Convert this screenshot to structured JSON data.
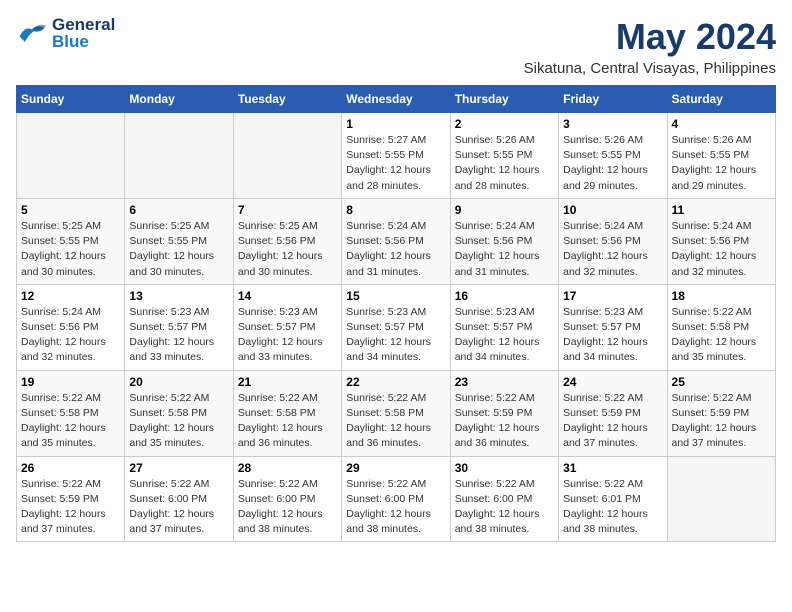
{
  "header": {
    "logo_general": "General",
    "logo_blue": "Blue",
    "title": "May 2024",
    "subtitle": "Sikatuna, Central Visayas, Philippines"
  },
  "calendar": {
    "days_of_week": [
      "Sunday",
      "Monday",
      "Tuesday",
      "Wednesday",
      "Thursday",
      "Friday",
      "Saturday"
    ],
    "weeks": [
      [
        {
          "day": "",
          "info": ""
        },
        {
          "day": "",
          "info": ""
        },
        {
          "day": "",
          "info": ""
        },
        {
          "day": "1",
          "info": "Sunrise: 5:27 AM\nSunset: 5:55 PM\nDaylight: 12 hours\nand 28 minutes."
        },
        {
          "day": "2",
          "info": "Sunrise: 5:26 AM\nSunset: 5:55 PM\nDaylight: 12 hours\nand 28 minutes."
        },
        {
          "day": "3",
          "info": "Sunrise: 5:26 AM\nSunset: 5:55 PM\nDaylight: 12 hours\nand 29 minutes."
        },
        {
          "day": "4",
          "info": "Sunrise: 5:26 AM\nSunset: 5:55 PM\nDaylight: 12 hours\nand 29 minutes."
        }
      ],
      [
        {
          "day": "5",
          "info": "Sunrise: 5:25 AM\nSunset: 5:55 PM\nDaylight: 12 hours\nand 30 minutes."
        },
        {
          "day": "6",
          "info": "Sunrise: 5:25 AM\nSunset: 5:55 PM\nDaylight: 12 hours\nand 30 minutes."
        },
        {
          "day": "7",
          "info": "Sunrise: 5:25 AM\nSunset: 5:56 PM\nDaylight: 12 hours\nand 30 minutes."
        },
        {
          "day": "8",
          "info": "Sunrise: 5:24 AM\nSunset: 5:56 PM\nDaylight: 12 hours\nand 31 minutes."
        },
        {
          "day": "9",
          "info": "Sunrise: 5:24 AM\nSunset: 5:56 PM\nDaylight: 12 hours\nand 31 minutes."
        },
        {
          "day": "10",
          "info": "Sunrise: 5:24 AM\nSunset: 5:56 PM\nDaylight: 12 hours\nand 32 minutes."
        },
        {
          "day": "11",
          "info": "Sunrise: 5:24 AM\nSunset: 5:56 PM\nDaylight: 12 hours\nand 32 minutes."
        }
      ],
      [
        {
          "day": "12",
          "info": "Sunrise: 5:24 AM\nSunset: 5:56 PM\nDaylight: 12 hours\nand 32 minutes."
        },
        {
          "day": "13",
          "info": "Sunrise: 5:23 AM\nSunset: 5:57 PM\nDaylight: 12 hours\nand 33 minutes."
        },
        {
          "day": "14",
          "info": "Sunrise: 5:23 AM\nSunset: 5:57 PM\nDaylight: 12 hours\nand 33 minutes."
        },
        {
          "day": "15",
          "info": "Sunrise: 5:23 AM\nSunset: 5:57 PM\nDaylight: 12 hours\nand 34 minutes."
        },
        {
          "day": "16",
          "info": "Sunrise: 5:23 AM\nSunset: 5:57 PM\nDaylight: 12 hours\nand 34 minutes."
        },
        {
          "day": "17",
          "info": "Sunrise: 5:23 AM\nSunset: 5:57 PM\nDaylight: 12 hours\nand 34 minutes."
        },
        {
          "day": "18",
          "info": "Sunrise: 5:22 AM\nSunset: 5:58 PM\nDaylight: 12 hours\nand 35 minutes."
        }
      ],
      [
        {
          "day": "19",
          "info": "Sunrise: 5:22 AM\nSunset: 5:58 PM\nDaylight: 12 hours\nand 35 minutes."
        },
        {
          "day": "20",
          "info": "Sunrise: 5:22 AM\nSunset: 5:58 PM\nDaylight: 12 hours\nand 35 minutes."
        },
        {
          "day": "21",
          "info": "Sunrise: 5:22 AM\nSunset: 5:58 PM\nDaylight: 12 hours\nand 36 minutes."
        },
        {
          "day": "22",
          "info": "Sunrise: 5:22 AM\nSunset: 5:58 PM\nDaylight: 12 hours\nand 36 minutes."
        },
        {
          "day": "23",
          "info": "Sunrise: 5:22 AM\nSunset: 5:59 PM\nDaylight: 12 hours\nand 36 minutes."
        },
        {
          "day": "24",
          "info": "Sunrise: 5:22 AM\nSunset: 5:59 PM\nDaylight: 12 hours\nand 37 minutes."
        },
        {
          "day": "25",
          "info": "Sunrise: 5:22 AM\nSunset: 5:59 PM\nDaylight: 12 hours\nand 37 minutes."
        }
      ],
      [
        {
          "day": "26",
          "info": "Sunrise: 5:22 AM\nSunset: 5:59 PM\nDaylight: 12 hours\nand 37 minutes."
        },
        {
          "day": "27",
          "info": "Sunrise: 5:22 AM\nSunset: 6:00 PM\nDaylight: 12 hours\nand 37 minutes."
        },
        {
          "day": "28",
          "info": "Sunrise: 5:22 AM\nSunset: 6:00 PM\nDaylight: 12 hours\nand 38 minutes."
        },
        {
          "day": "29",
          "info": "Sunrise: 5:22 AM\nSunset: 6:00 PM\nDaylight: 12 hours\nand 38 minutes."
        },
        {
          "day": "30",
          "info": "Sunrise: 5:22 AM\nSunset: 6:00 PM\nDaylight: 12 hours\nand 38 minutes."
        },
        {
          "day": "31",
          "info": "Sunrise: 5:22 AM\nSunset: 6:01 PM\nDaylight: 12 hours\nand 38 minutes."
        },
        {
          "day": "",
          "info": ""
        }
      ]
    ]
  }
}
